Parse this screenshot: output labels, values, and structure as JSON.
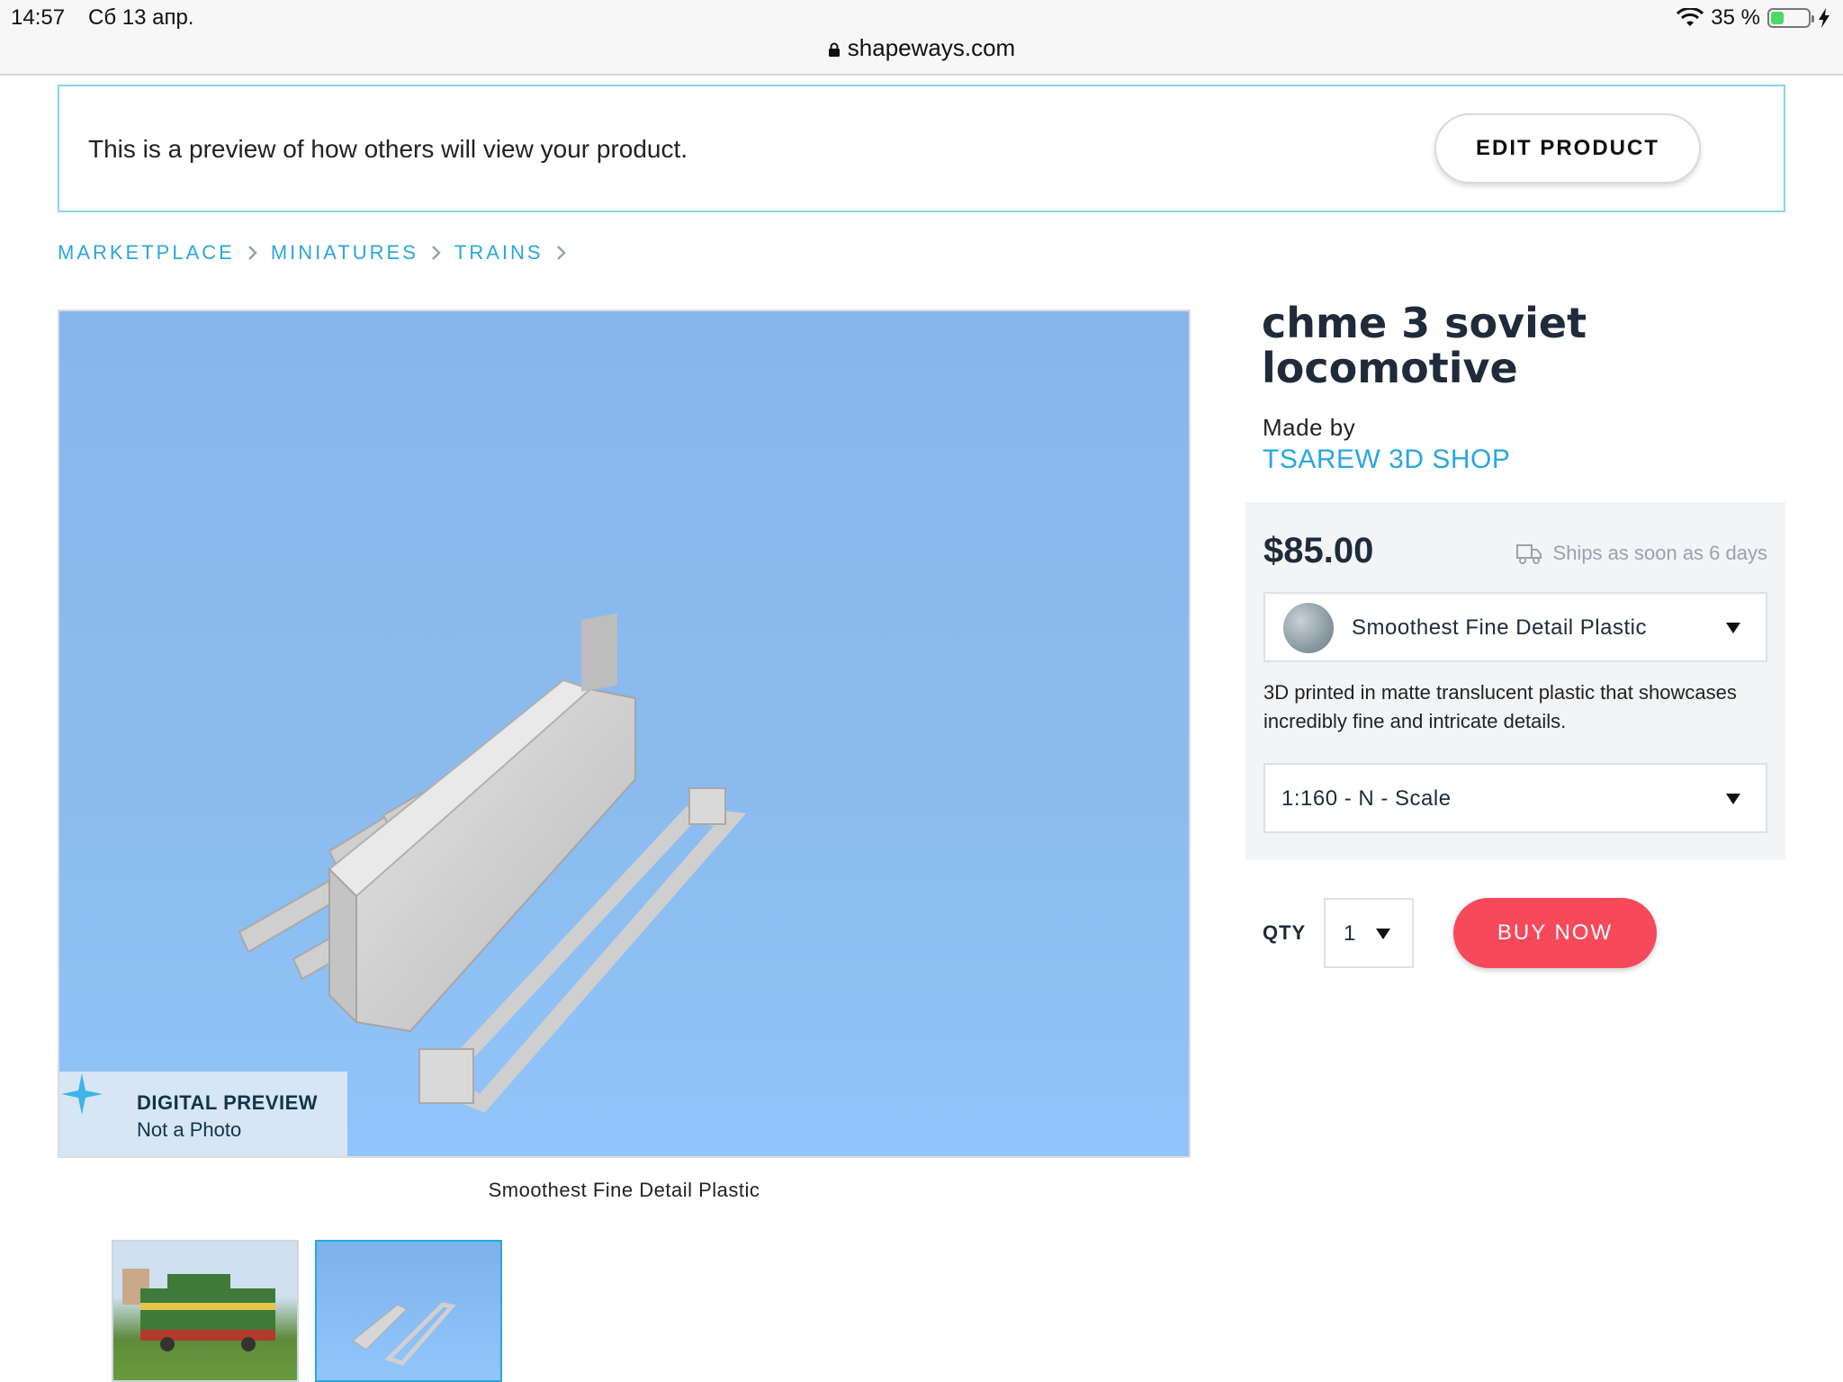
{
  "status_bar": {
    "time": "14:57",
    "date": "Сб 13 апр.",
    "battery_text": "35 %",
    "battery_level": 0.35,
    "battery_color": "#4cd964"
  },
  "browser": {
    "url": "shapeways.com",
    "lock_icon": "lock-icon"
  },
  "notice": {
    "text": "This is a preview of how others will view your product.",
    "edit_button": "EDIT PRODUCT"
  },
  "breadcrumb": {
    "items": [
      "MARKETPLACE",
      "MINIATURES",
      "TRAINS"
    ]
  },
  "main_image": {
    "badge_title": "DIGITAL PREVIEW",
    "badge_subtitle": "Not a Photo",
    "caption": "Smoothest Fine Detail Plastic"
  },
  "product": {
    "title": "chme 3 soviet locomotive",
    "made_by_label": "Made by",
    "shop": "TSAREW 3D SHOP",
    "price": "$85.00",
    "ships": "Ships as soon as 6 days",
    "material": "Smoothest Fine Detail Plastic",
    "description": "3D printed in matte translucent plastic that showcases incredibly fine and intricate details.",
    "scale": "1:160 - N - Scale",
    "qty_label": "QTY",
    "qty": "1",
    "buy_button": "BUY NOW"
  },
  "colors": {
    "accent": "#2aa6df",
    "buy": "#f7495a",
    "notice_border": "#8bd3e6",
    "preview_bg": "#8bbbee"
  }
}
